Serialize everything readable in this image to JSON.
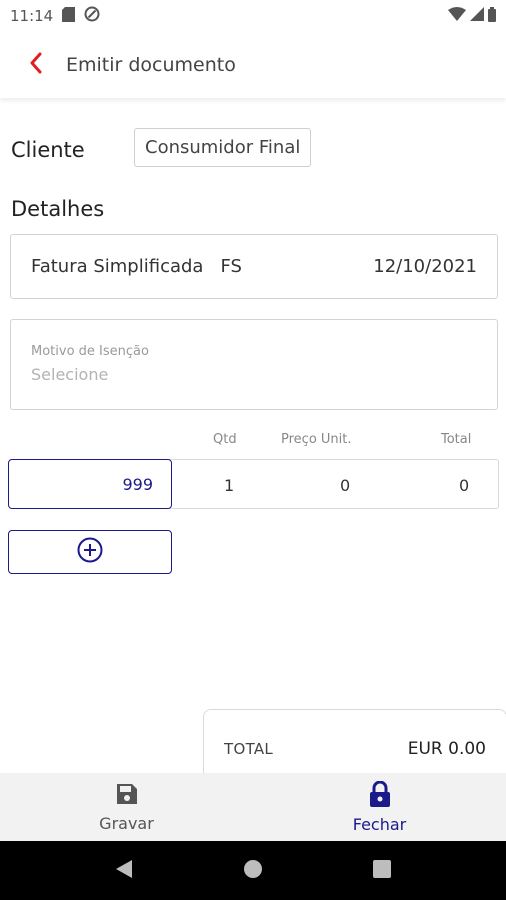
{
  "status_bar": {
    "time": "11:14",
    "icons": [
      "sd-card-icon",
      "data-saver-icon",
      "wifi-icon",
      "signal-icon",
      "battery-icon"
    ]
  },
  "app_bar": {
    "title": "Emitir documento",
    "back_icon": "chevron-left-icon"
  },
  "form": {
    "cliente_label": "Cliente",
    "cliente_value": "Consumidor Final",
    "detalhes_label": "Detalhes",
    "document": {
      "type": "Fatura Simplificada",
      "series": "FS",
      "date": "12/10/2021"
    },
    "motivo": {
      "label": "Motivo de Isenção",
      "placeholder": "Selecione"
    }
  },
  "lines": {
    "columns": {
      "qty": "Qtd",
      "unit_price": "Preço Unit.",
      "total": "Total"
    },
    "rows": [
      {
        "item": "999",
        "qty": "1",
        "unit_price": "0",
        "total": "0"
      }
    ],
    "add_icon": "plus-circle-icon"
  },
  "totals": {
    "label": "TOTAL",
    "value": "EUR 0.00"
  },
  "bottom_nav": {
    "gravar": {
      "label": "Gravar",
      "icon": "save-icon"
    },
    "fechar": {
      "label": "Fechar",
      "icon": "lock-icon"
    }
  },
  "colors": {
    "accent": "#1a1a8a",
    "back_arrow": "#e02020",
    "bottom_nav_bg": "#f2f2f2",
    "system_nav_bg": "#000000"
  }
}
